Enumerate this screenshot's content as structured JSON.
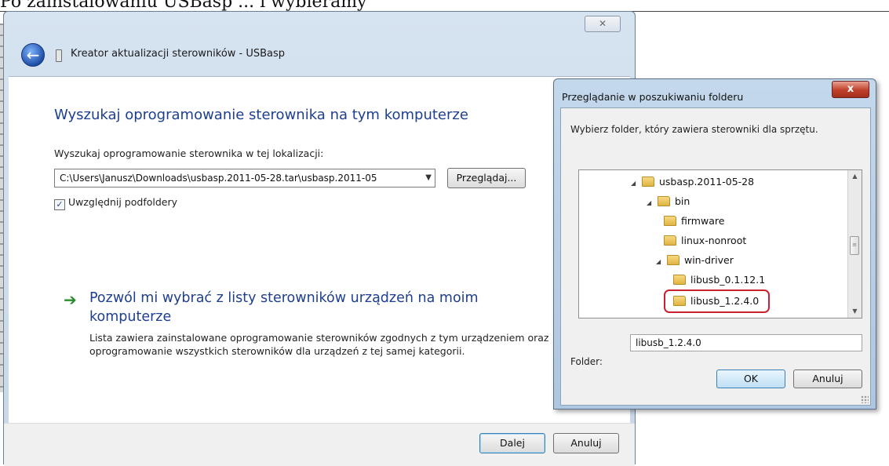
{
  "caption": "Po zainstalowaniu USBasp ... i wybieramy",
  "wizard": {
    "close_glyph": "✕",
    "title": "Kreator aktualizacji sterowników - USBasp",
    "heading": "Wyszukaj oprogramowanie sterownika na tym komputerze",
    "location_label": "Wyszukaj oprogramowanie sterownika w tej lokalizacji:",
    "path_value": "C:\\Users\\Janusz\\Downloads\\usbasp.2011-05-28.tar\\usbasp.2011-05",
    "browse_label": "Przeglądaj...",
    "include_subfolders_label": "Uwzględnij podfoldery",
    "include_subfolders_checked": true,
    "option_title": "Pozwól mi wybrać z listy sterowników urządzeń na moim komputerze",
    "option_desc": "Lista zawiera zainstalowane oprogramowanie sterowników zgodnych z tym urządzeniem oraz oprogramowanie wszystkich sterowników dla urządzeń z tej samej kategorii.",
    "next_label": "Dalej",
    "cancel_label": "Anuluj"
  },
  "dialog": {
    "title": "Przeglądanie w poszukiwaniu folderu",
    "close_glyph": "x",
    "description": "Wybierz folder, który zawiera sterowniki dla sprzętu.",
    "tree": [
      {
        "label": "usbasp.2011-05-28",
        "expanded": true
      },
      {
        "label": "bin",
        "expanded": true
      },
      {
        "label": "firmware",
        "expanded": false
      },
      {
        "label": "linux-nonroot",
        "expanded": false
      },
      {
        "label": "win-driver",
        "expanded": true
      },
      {
        "label": "libusb_0.1.12.1",
        "expanded": false
      },
      {
        "label": "libusb_1.2.4.0",
        "expanded": false,
        "selected": true
      }
    ],
    "folder_label": "Folder:",
    "folder_value": "libusb_1.2.4.0",
    "ok_label": "OK",
    "cancel_label": "Anuluj"
  },
  "colors": {
    "heading_blue": "#1e3f8f",
    "selection_ring": "#c8222e",
    "arrow_green": "#2b8c2b"
  }
}
